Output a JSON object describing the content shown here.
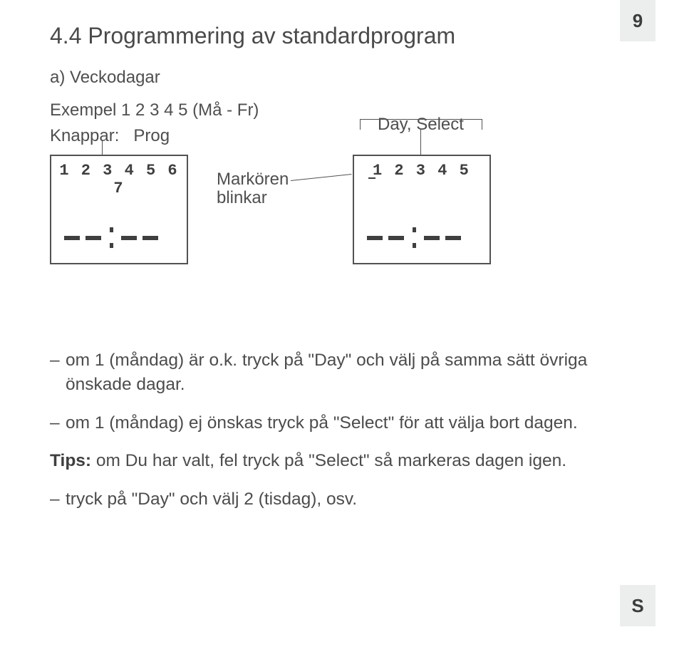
{
  "page_number": "9",
  "side_tab": "S",
  "heading": "4.4 Programmering av standardprogram",
  "sub_a": "a) Veckodagar",
  "example_line": "Exempel 1 2 3 4 5 (Må - Fr)",
  "knappar_label": "Knappar:",
  "button_prog": "Prog",
  "button_day_select": "Day, Select",
  "cursor_label_l1": "Markören",
  "cursor_label_l2": "blinkar",
  "lcd_left_digits": "1 2 3 4 5 6 7",
  "lcd_right_digits": "1 2 3 4 5",
  "bullets": {
    "b1": "om 1 (måndag) är o.k. tryck på \"Day\" och välj på samma sätt övriga önskade dagar.",
    "b2": "om 1 (måndag) ej önskas tryck på \"Select\" för att välja bort dagen.",
    "tips_prefix": "Tips:",
    "tips_rest": " om Du har valt, fel tryck på \"Select\" så markeras dagen igen.",
    "b3": "tryck på \"Day\" och välj 2 (tisdag), osv."
  }
}
